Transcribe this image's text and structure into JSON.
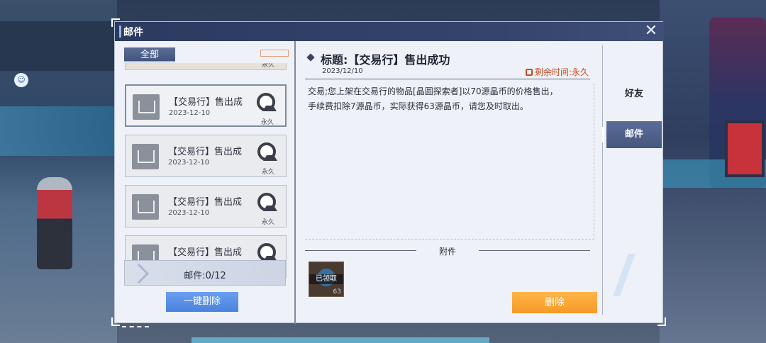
{
  "window": {
    "title": "邮件",
    "close_glyph": "✕"
  },
  "filter_tab": "全部",
  "mail_list": {
    "partial_top_expire": "永久",
    "items": [
      {
        "subject": "【交易行】售出成",
        "date": "2023-12-10",
        "expire": "永久",
        "selected": true
      },
      {
        "subject": "【交易行】售出成",
        "date": "2023-12-10",
        "expire": "永久",
        "selected": false
      },
      {
        "subject": "【交易行】售出成",
        "date": "2023-12-10",
        "expire": "永久",
        "selected": false
      },
      {
        "subject": "【交易行】售出成",
        "date": "",
        "expire": "",
        "selected": false
      }
    ],
    "count_label": "邮件:0/12",
    "delete_all_label": "一键删除"
  },
  "mail_detail": {
    "heading": "标题:【交易行】售出成功",
    "date": "2023/12/10",
    "remaining": "剩余时间:永久",
    "body": "交易;您上架在交易行的物品[晶圆探索者]以70源晶币的价格售出，手续费扣除7源晶币，实际获得63源晶币，请您及时取出。",
    "attachments_label": "附件",
    "attachment": {
      "status": "已领取",
      "quantity": "63"
    },
    "delete_label": "删除"
  },
  "side_tabs": {
    "friends": "好友",
    "mail": "邮件"
  },
  "icons": [
    "close-icon",
    "envelope-icon",
    "seal-icon",
    "clock-icon",
    "diamond-icon"
  ],
  "colors": {
    "titlebar": "#2c3a60",
    "delete_button": "#f59a25",
    "delete_all_button": "#4a82dc",
    "remaining_text": "#c84a1f",
    "active_tab": "#46577f"
  }
}
